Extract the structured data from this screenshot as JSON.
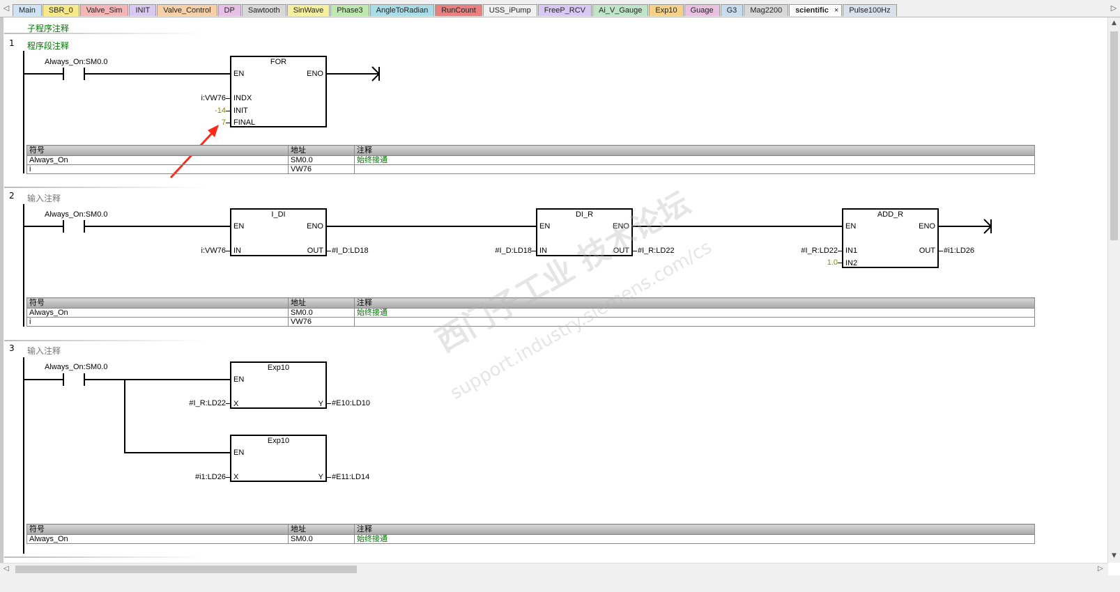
{
  "tabs": [
    {
      "label": "Main",
      "color": "#cfe3f7"
    },
    {
      "label": "SBR_0",
      "color": "#f7e98a"
    },
    {
      "label": "Valve_Sim",
      "color": "#f4b6b6"
    },
    {
      "label": "INIT",
      "color": "#d9c8f0"
    },
    {
      "label": "Valve_Control",
      "color": "#f7d0a8"
    },
    {
      "label": "DP",
      "color": "#e7c0e8"
    },
    {
      "label": "Sawtooth",
      "color": "#d8d8d8"
    },
    {
      "label": "SinWave",
      "color": "#f4f0a0"
    },
    {
      "label": "Phase3",
      "color": "#bfe8b0"
    },
    {
      "label": "AngleToRadian",
      "color": "#a8dde8"
    },
    {
      "label": "RunCount",
      "color": "#e88080"
    },
    {
      "label": "USS_iPump",
      "color": "#f0f0f0"
    },
    {
      "label": "FreeP_RCV",
      "color": "#d8c8f4"
    },
    {
      "label": "Ai_V_Gauge",
      "color": "#c0e4c8"
    },
    {
      "label": "Exp10",
      "color": "#f7d08a"
    },
    {
      "label": "Guage",
      "color": "#e8c0e0"
    },
    {
      "label": "G3",
      "color": "#c8dcf0"
    },
    {
      "label": "Mag2200",
      "color": "#d8d8d8"
    },
    {
      "label": "scientific",
      "color": "#ffffff",
      "active": true,
      "close": "×"
    },
    {
      "label": "Pulse100Hz",
      "color": "#d8e0ec"
    }
  ],
  "subroutine_comment": "子程序注释",
  "rungs": [
    {
      "number": "1",
      "comment": "程序段注释",
      "contact": "Always_On:SM0.0",
      "box": {
        "title": "FOR",
        "en": "EN",
        "eno": "ENO",
        "pins": [
          "INDX",
          "INIT",
          "FINAL"
        ]
      },
      "inputs": [
        "i:VW76",
        "-14",
        "7"
      ],
      "symbols": {
        "headers": [
          "符号",
          "地址",
          "注释"
        ],
        "rows": [
          [
            "Always_On",
            "SM0.0",
            "始终接通"
          ],
          [
            "i",
            "VW76",
            ""
          ]
        ]
      }
    },
    {
      "number": "2",
      "comment": "输入注释",
      "contact": "Always_On:SM0.0",
      "box1": {
        "title": "I_DI",
        "en": "EN",
        "eno": "ENO",
        "in": "IN",
        "out": "OUT",
        "in_val": "i:VW76",
        "out_val": "#I_D:LD18"
      },
      "box2": {
        "title": "DI_R",
        "en": "EN",
        "eno": "ENO",
        "in": "IN",
        "out": "OUT",
        "in_val": "#I_D:LD18",
        "out_val": "#I_R:LD22"
      },
      "box3": {
        "title": "ADD_R",
        "en": "EN",
        "eno": "ENO",
        "in1": "IN1",
        "in2": "IN2",
        "out": "OUT",
        "in1_val": "#I_R:LD22",
        "in2_val": "1.0",
        "out_val": "#i1:LD26"
      },
      "symbols": {
        "headers": [
          "符号",
          "地址",
          "注释"
        ],
        "rows": [
          [
            "Always_On",
            "SM0.0",
            "始终接通"
          ],
          [
            "i",
            "VW76",
            ""
          ]
        ]
      }
    },
    {
      "number": "3",
      "comment": "输入注释",
      "contact": "Always_On:SM0.0",
      "box1": {
        "title": "Exp10",
        "en": "EN",
        "x": "X",
        "y": "Y",
        "x_val": "#I_R:LD22",
        "y_val": "#E10:LD10"
      },
      "box2": {
        "title": "Exp10",
        "en": "EN",
        "x": "X",
        "y": "Y",
        "x_val": "#i1:LD26",
        "y_val": "#E11:LD14"
      },
      "symbols": {
        "headers": [
          "符号",
          "地址",
          "注释"
        ],
        "rows": [
          [
            "Always_On",
            "SM0.0",
            "始终接通"
          ]
        ]
      }
    }
  ],
  "watermark": {
    "line1": "西门子工业 技术论坛",
    "line2": "support.industry.siemens.com/cs"
  },
  "nav": {
    "left": "◁",
    "right": "▷",
    "up": "▲",
    "down": "▼"
  }
}
